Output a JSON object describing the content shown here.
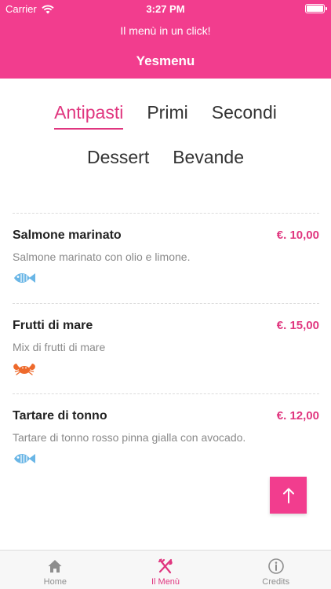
{
  "status_bar": {
    "carrier": "Carrier",
    "time": "3:27 PM"
  },
  "header": {
    "subtitle": "Il menù in un click!",
    "title": "Yesmenu"
  },
  "categories": [
    {
      "label": "Antipasti",
      "active": true
    },
    {
      "label": "Primi"
    },
    {
      "label": "Secondi"
    },
    {
      "label": "Dessert"
    },
    {
      "label": "Bevande"
    }
  ],
  "menu_items": [
    {
      "name": "Salmone marinato",
      "price": "€. 10,00",
      "description": "Salmone marinato con olio e limone.",
      "icon": "fish-icon"
    },
    {
      "name": "Frutti di mare",
      "price": "€. 15,00",
      "description": "Mix di frutti di mare",
      "icon": "crab-icon"
    },
    {
      "name": "Tartare di tonno",
      "price": "€. 12,00",
      "description": "Tartare di tonno rosso pinna gialla con avocado.",
      "icon": "fish-icon"
    }
  ],
  "tabbar": [
    {
      "label": "Home",
      "icon": "home-icon"
    },
    {
      "label": "Il Menù",
      "icon": "fork-knife-icon",
      "active": true
    },
    {
      "label": "Credits",
      "icon": "info-icon"
    }
  ],
  "colors": {
    "brand": "#f23d8e",
    "accent": "#e0367f",
    "fish": "#6ab6e6",
    "crab": "#ee6a2c"
  }
}
